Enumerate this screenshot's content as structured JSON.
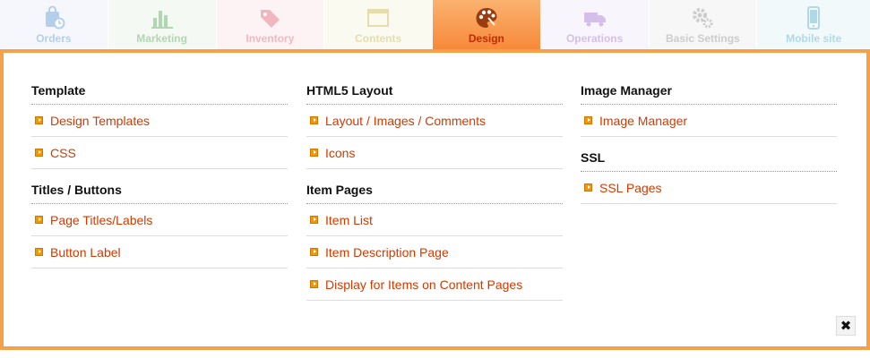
{
  "tabs": [
    {
      "id": "orders",
      "label": "Orders",
      "active": false,
      "icon": "orders-icon",
      "color": "#4a8fd0",
      "bg": "#e8eef8"
    },
    {
      "id": "marketing",
      "label": "Marketing",
      "active": false,
      "icon": "bar-chart-icon",
      "color": "#48a048",
      "bg": "#e7f2e4"
    },
    {
      "id": "inventory",
      "label": "Inventory",
      "active": false,
      "icon": "tag-icon",
      "color": "#e0566e",
      "bg": "#fbe3e6"
    },
    {
      "id": "contents",
      "label": "Contents",
      "active": false,
      "icon": "window-icon",
      "color": "#c2b038",
      "bg": "#f6f4dc"
    },
    {
      "id": "design",
      "label": "Design",
      "active": true,
      "icon": "palette-icon",
      "color": "#c22a00",
      "bg": "#f89443"
    },
    {
      "id": "operations",
      "label": "Operations",
      "active": false,
      "icon": "truck-icon",
      "color": "#9a68d0",
      "bg": "#f0e8f9"
    },
    {
      "id": "basic-settings",
      "label": "Basic Settings",
      "active": false,
      "icon": "gears-icon",
      "color": "#888888",
      "bg": "#ededed"
    },
    {
      "id": "mobile-site",
      "label": "Mobile site",
      "active": false,
      "icon": "mobile-icon",
      "color": "#46a6c6",
      "bg": "#e2f1f6"
    }
  ],
  "columns": [
    {
      "sections": [
        {
          "title": "Template",
          "links": [
            "Design Templates",
            "CSS"
          ]
        },
        {
          "title": "Titles / Buttons",
          "links": [
            "Page Titles/Labels",
            "Button Label"
          ]
        }
      ]
    },
    {
      "sections": [
        {
          "title": "HTML5 Layout",
          "links": [
            "Layout / Images / Comments",
            "Icons"
          ]
        },
        {
          "title": "Item Pages",
          "links": [
            "Item List",
            "Item Description Page",
            "Display for Items on Content Pages"
          ]
        }
      ]
    },
    {
      "sections": [
        {
          "title": "Image Manager",
          "links": [
            "Image Manager"
          ]
        },
        {
          "title": "SSL",
          "links": [
            "SSL Pages"
          ]
        }
      ]
    }
  ],
  "close_symbol": "✖",
  "colors": {
    "accent": "#f7a04a",
    "link": "#d23a00",
    "bullet": "#f29700"
  }
}
